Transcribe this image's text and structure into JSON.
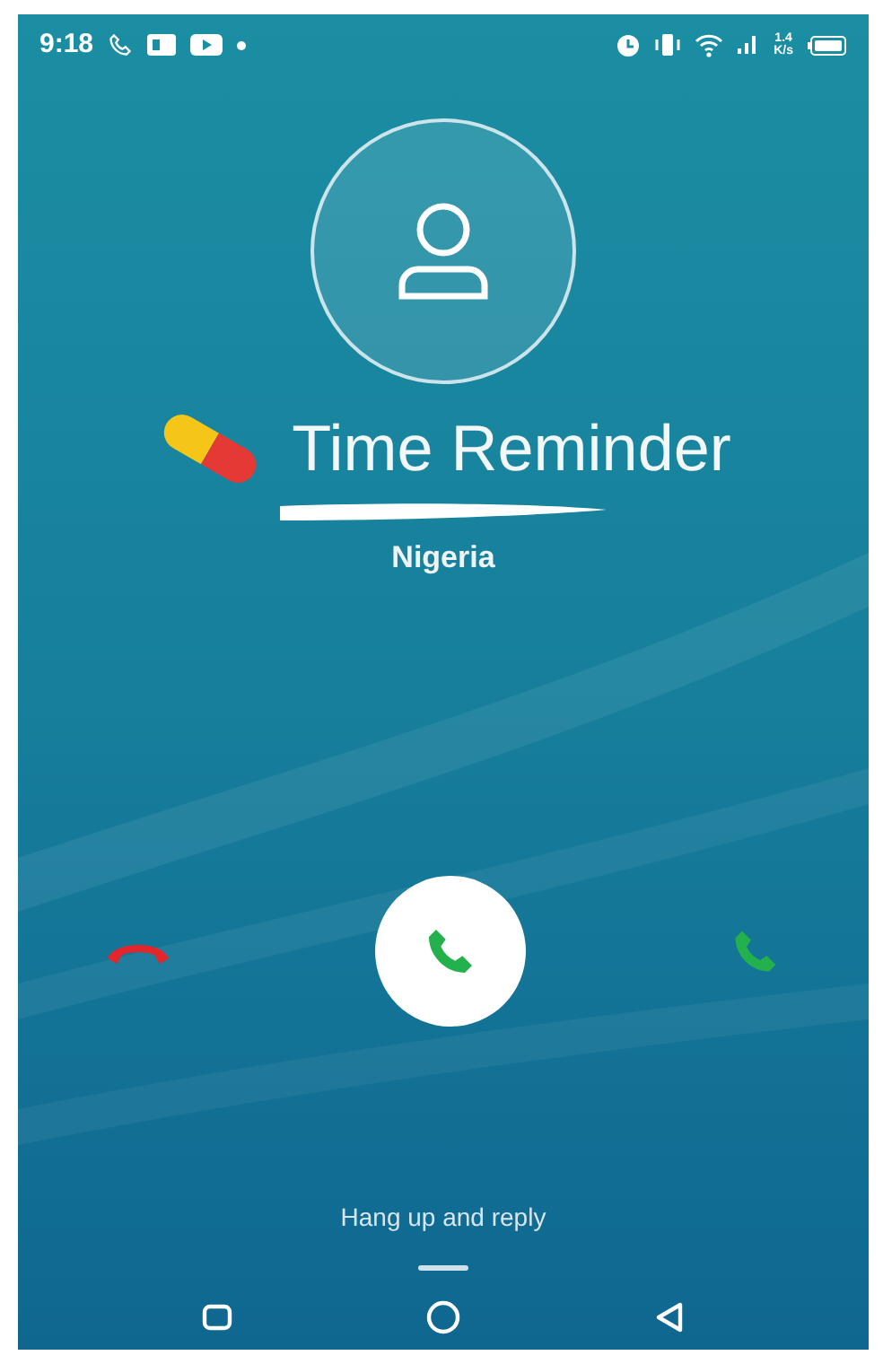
{
  "status_bar": {
    "time": "9:18",
    "net_speed": [
      "1.4",
      "K/s"
    ]
  },
  "caller": {
    "name": "Time Reminder",
    "number_redacted": true,
    "location": "Nigeria"
  },
  "hint": "Hang up and reply"
}
